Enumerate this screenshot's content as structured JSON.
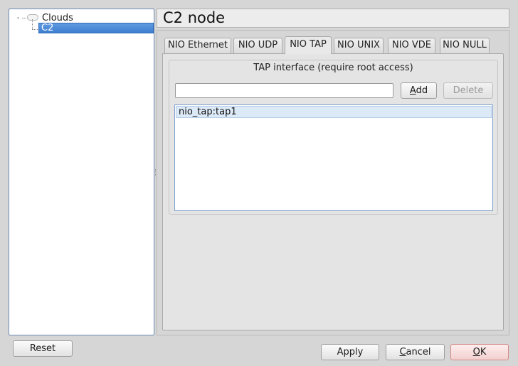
{
  "tree": {
    "root_label": "Clouds",
    "expander": "-",
    "root_icon": "cloud-icon",
    "children": [
      {
        "label": "C2",
        "selected": true
      }
    ]
  },
  "header": {
    "title": "C2 node"
  },
  "tabs": [
    {
      "label": "NIO Ethernet",
      "active": false
    },
    {
      "label": "NIO UDP",
      "active": false
    },
    {
      "label": "NIO TAP",
      "active": true
    },
    {
      "label": "NIO UNIX",
      "active": false
    },
    {
      "label": "NIO VDE",
      "active": false
    },
    {
      "label": "NIO NULL",
      "active": false
    }
  ],
  "tap_panel": {
    "group_title": "TAP interface (require root access)",
    "input_value": "",
    "add_button": {
      "prefix": "",
      "mnemonic": "A",
      "suffix": "dd"
    },
    "delete_button": {
      "label": "Delete",
      "enabled": false
    },
    "list_items": [
      "nio_tap:tap1"
    ]
  },
  "footer": {
    "reset": "Reset",
    "apply": "Apply",
    "cancel": {
      "prefix": "",
      "mnemonic": "C",
      "suffix": "ancel"
    },
    "ok": {
      "prefix": "",
      "mnemonic": "O",
      "suffix": "K"
    }
  },
  "colors": {
    "selection": "#3e7fd1",
    "list_selection": "#dce9f7",
    "ok_button": "#f2d0cf",
    "window_bg": "#d6d6d6"
  }
}
